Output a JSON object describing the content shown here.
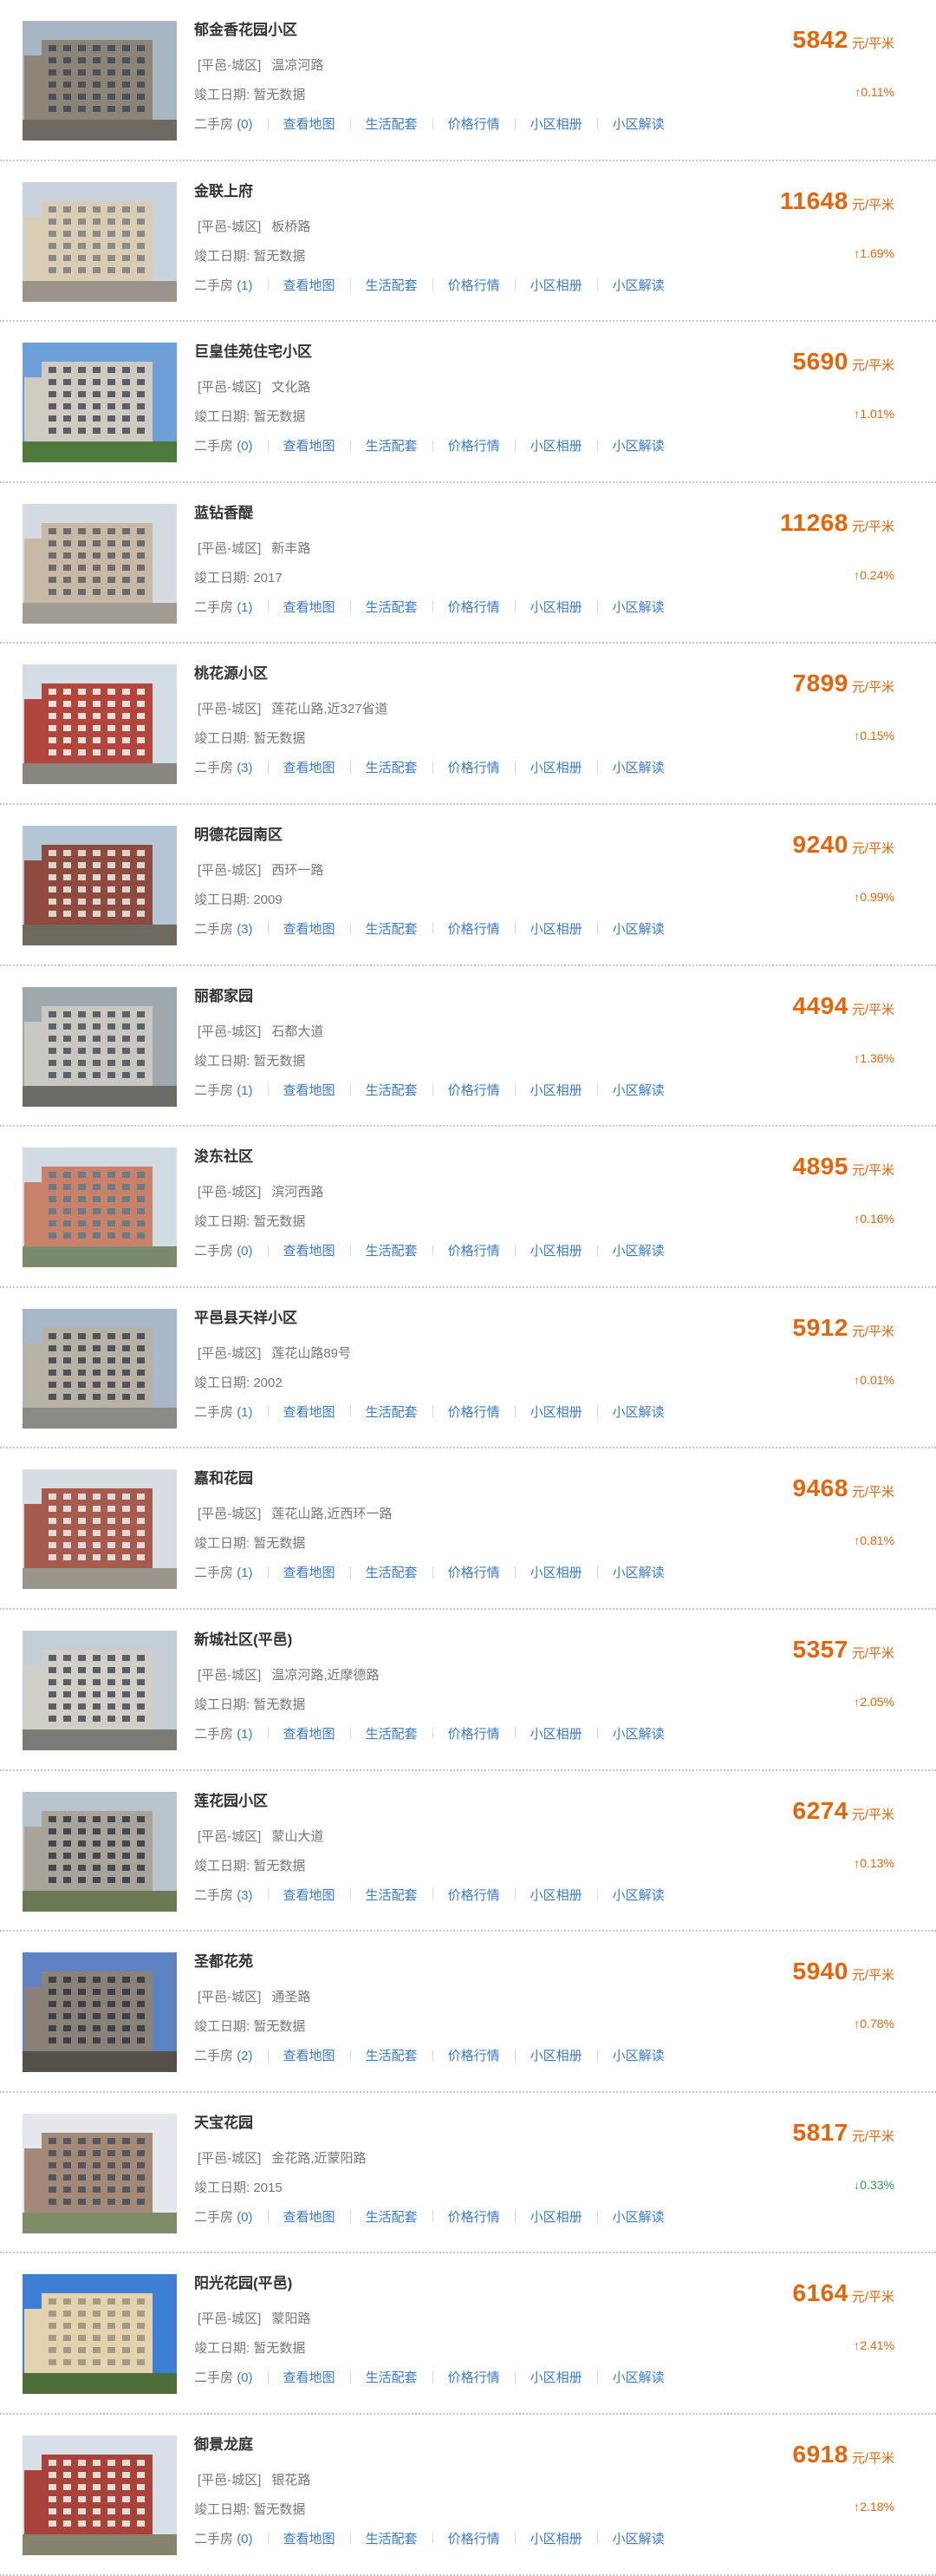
{
  "communities": [
    {
      "name": "郁金香花园小区",
      "district": "[平邑-城区]",
      "road": "温凉河路",
      "date_label": "竣工日期:",
      "date": "暂无数据",
      "secondhand_label": "二手房",
      "secondhand_count": "(0)",
      "price": "5842",
      "unit": "元/平米",
      "change_arrow": "↑",
      "change": "0.11%",
      "trend": "up",
      "colors": {
        "sky": "#a9b6c4",
        "building": "#8d8478",
        "window": "#4c5058",
        "ground": "#6e6a62"
      }
    },
    {
      "name": "金联上府",
      "district": "[平邑-城区]",
      "road": "板桥路",
      "date_label": "竣工日期:",
      "date": "暂无数据",
      "secondhand_label": "二手房",
      "secondhand_count": "(1)",
      "price": "11648",
      "unit": "元/平米",
      "change_arrow": "↑",
      "change": "1.69%",
      "trend": "up",
      "colors": {
        "sky": "#c9d3dd",
        "building": "#d9cdb6",
        "window": "#8a8a86",
        "ground": "#9a948a"
      }
    },
    {
      "name": "巨皇佳苑住宅小区",
      "district": "[平邑-城区]",
      "road": "文化路",
      "date_label": "竣工日期:",
      "date": "暂无数据",
      "secondhand_label": "二手房",
      "secondhand_count": "(0)",
      "price": "5690",
      "unit": "元/平米",
      "change_arrow": "↑",
      "change": "1.01%",
      "trend": "up",
      "colors": {
        "sky": "#6f9fd8",
        "building": "#cfcac2",
        "window": "#5b5e66",
        "ground": "#4f7a3e"
      }
    },
    {
      "name": "蓝钻香醍",
      "district": "[平邑-城区]",
      "road": "新丰路",
      "date_label": "竣工日期:",
      "date": "2017",
      "secondhand_label": "二手房",
      "secondhand_count": "(1)",
      "price": "11268",
      "unit": "元/平米",
      "change_arrow": "↑",
      "change": "0.24%",
      "trend": "up",
      "colors": {
        "sky": "#d4dbe2",
        "building": "#c8b9a6",
        "window": "#6d6c6c",
        "ground": "#a09c94"
      }
    },
    {
      "name": "桃花源小区",
      "district": "[平邑-城区]",
      "road": "莲花山路,近327省道",
      "date_label": "竣工日期:",
      "date": "暂无数据",
      "secondhand_label": "二手房",
      "secondhand_count": "(3)",
      "price": "7899",
      "unit": "元/平米",
      "change_arrow": "↑",
      "change": "0.15%",
      "trend": "up",
      "colors": {
        "sky": "#d5dde4",
        "building": "#b2453c",
        "window": "#e7e1da",
        "ground": "#8a8780"
      }
    },
    {
      "name": "明德花园南区",
      "district": "[平邑-城区]",
      "road": "西环一路",
      "date_label": "竣工日期:",
      "date": "2009",
      "secondhand_label": "二手房",
      "secondhand_count": "(3)",
      "price": "9240",
      "unit": "元/平米",
      "change_arrow": "↑",
      "change": "0.99%",
      "trend": "up",
      "colors": {
        "sky": "#b6c5d6",
        "building": "#8f4a40",
        "window": "#dcd6cc",
        "ground": "#6f6a60"
      }
    },
    {
      "name": "丽都家园",
      "district": "[平邑-城区]",
      "road": "石都大道",
      "date_label": "竣工日期:",
      "date": "暂无数据",
      "secondhand_label": "二手房",
      "secondhand_count": "(1)",
      "price": "4494",
      "unit": "元/平米",
      "change_arrow": "↑",
      "change": "1.36%",
      "trend": "up",
      "colors": {
        "sky": "#9fa8ad",
        "building": "#c9c7c1",
        "window": "#5e6166",
        "ground": "#6a6d66"
      }
    },
    {
      "name": "浚东社区",
      "district": "[平邑-城区]",
      "road": "滨河西路",
      "date_label": "竣工日期:",
      "date": "暂无数据",
      "secondhand_label": "二手房",
      "secondhand_count": "(0)",
      "price": "4895",
      "unit": "元/平米",
      "change_arrow": "↑",
      "change": "0.16%",
      "trend": "up",
      "colors": {
        "sky": "#d3dbe3",
        "building": "#c9826a",
        "window": "#6e7a86",
        "ground": "#7a8a6c"
      }
    },
    {
      "name": "平邑县天祥小区",
      "district": "[平邑-城区]",
      "road": "莲花山路89号",
      "date_label": "竣工日期:",
      "date": "2002",
      "secondhand_label": "二手房",
      "secondhand_count": "(1)",
      "price": "5912",
      "unit": "元/平米",
      "change_arrow": "↑",
      "change": "0.01%",
      "trend": "up",
      "colors": {
        "sky": "#a8b8c9",
        "building": "#b8b1a6",
        "window": "#4f5358",
        "ground": "#8c8a84"
      }
    },
    {
      "name": "嘉和花园",
      "district": "[平邑-城区]",
      "road": "莲花山路,近西环一路",
      "date_label": "竣工日期:",
      "date": "暂无数据",
      "secondhand_label": "二手房",
      "secondhand_count": "(1)",
      "price": "9468",
      "unit": "元/平米",
      "change_arrow": "↑",
      "change": "0.81%",
      "trend": "up",
      "colors": {
        "sky": "#d6dde3",
        "building": "#a65b4e",
        "window": "#e0dbd4",
        "ground": "#9a968e"
      }
    },
    {
      "name": "新城社区(平邑)",
      "district": "[平邑-城区]",
      "road": "温凉河路,近摩德路",
      "date_label": "竣工日期:",
      "date": "暂无数据",
      "secondhand_label": "二手房",
      "secondhand_count": "(1)",
      "price": "5357",
      "unit": "元/平米",
      "change_arrow": "↑",
      "change": "2.05%",
      "trend": "up",
      "colors": {
        "sky": "#c4ccd4",
        "building": "#d2cfc9",
        "window": "#5a5e66",
        "ground": "#7b7a76"
      }
    },
    {
      "name": "莲花园小区",
      "district": "[平邑-城区]",
      "road": "蒙山大道",
      "date_label": "竣工日期:",
      "date": "暂无数据",
      "secondhand_label": "二手房",
      "secondhand_count": "(3)",
      "price": "6274",
      "unit": "元/平米",
      "change_arrow": "↑",
      "change": "0.13%",
      "trend": "up",
      "colors": {
        "sky": "#b9c4cc",
        "building": "#a9a49b",
        "window": "#44474c",
        "ground": "#6b7a55"
      }
    },
    {
      "name": "圣都花苑",
      "district": "[平邑-城区]",
      "road": "通圣路",
      "date_label": "竣工日期:",
      "date": "暂无数据",
      "secondhand_label": "二手房",
      "secondhand_count": "(2)",
      "price": "5940",
      "unit": "元/平米",
      "change_arrow": "↑",
      "change": "0.78%",
      "trend": "up",
      "colors": {
        "sky": "#5d83c4",
        "building": "#8a8278",
        "window": "#3e4048",
        "ground": "#55504a"
      }
    },
    {
      "name": "天宝花园",
      "district": "[平邑-城区]",
      "road": "金花路,近蒙阳路",
      "date_label": "竣工日期:",
      "date": "2015",
      "secondhand_label": "二手房",
      "secondhand_count": "(0)",
      "price": "5817",
      "unit": "元/平米",
      "change_arrow": "↓",
      "change": "0.33%",
      "trend": "down",
      "colors": {
        "sky": "#e4e8ec",
        "building": "#a38a78",
        "window": "#55575c",
        "ground": "#7e8c68"
      }
    },
    {
      "name": "阳光花园(平邑)",
      "district": "[平邑-城区]",
      "road": "蒙阳路",
      "date_label": "竣工日期:",
      "date": "暂无数据",
      "secondhand_label": "二手房",
      "secondhand_count": "(0)",
      "price": "6164",
      "unit": "元/平米",
      "change_arrow": "↑",
      "change": "2.41%",
      "trend": "up",
      "colors": {
        "sky": "#3e7fd6",
        "building": "#e4d3ae",
        "window": "#a39b88",
        "ground": "#4c6e3a"
      }
    },
    {
      "name": "御景龙庭",
      "district": "[平邑-城区]",
      "road": "银花路",
      "date_label": "竣工日期:",
      "date": "暂无数据",
      "secondhand_label": "二手房",
      "secondhand_count": "(0)",
      "price": "6918",
      "unit": "元/平米",
      "change_arrow": "↑",
      "change": "2.18%",
      "trend": "up",
      "colors": {
        "sky": "#d8dfe6",
        "building": "#a8423a",
        "window": "#e2ddd5",
        "ground": "#86846e"
      }
    }
  ],
  "links": {
    "map": "查看地图",
    "life": "生活配套",
    "price_trend": "价格行情",
    "album": "小区相册",
    "review": "小区解读"
  }
}
